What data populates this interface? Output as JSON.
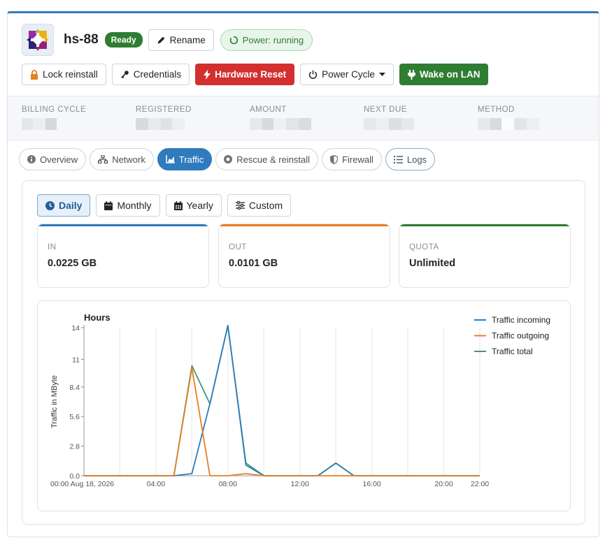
{
  "server": {
    "hostname": "hs-88",
    "status_badge": "Ready",
    "rename_label": "Rename",
    "power_status": "Power: running"
  },
  "actions": {
    "lock_reinstall": "Lock reinstall",
    "credentials": "Credentials",
    "hardware_reset": "Hardware Reset",
    "power_cycle": "Power Cycle",
    "wake_on_lan": "Wake on LAN"
  },
  "billing": {
    "billing_cycle": "BILLING CYCLE",
    "registered": "REGISTERED",
    "amount": "AMOUNT",
    "next_due": "NEXT DUE",
    "method": "METHOD"
  },
  "tabs": {
    "overview": "Overview",
    "network": "Network",
    "traffic": "Traffic",
    "rescue": "Rescue & reinstall",
    "firewall": "Firewall",
    "logs": "Logs"
  },
  "ranges": {
    "daily": "Daily",
    "monthly": "Monthly",
    "yearly": "Yearly",
    "custom": "Custom"
  },
  "stats": {
    "in_label": "IN",
    "in_value": "0.0225 GB",
    "out_label": "OUT",
    "out_value": "0.0101 GB",
    "quota_label": "QUOTA",
    "quota_value": "Unlimited"
  },
  "colors": {
    "accent": "#2f7bbd",
    "danger": "#d32f2f",
    "success": "#2e7d32",
    "incoming": "#2f7bbd",
    "outgoing": "#e67e22",
    "total": "#3a9a6e"
  },
  "chart_data": {
    "type": "line",
    "title": "Hours",
    "xlabel": "",
    "ylabel": "Traffic in MByte",
    "x": [
      "00:00",
      "01:00",
      "02:00",
      "03:00",
      "04:00",
      "05:00",
      "06:00",
      "07:00",
      "08:00",
      "09:00",
      "10:00",
      "11:00",
      "12:00",
      "13:00",
      "14:00",
      "15:00",
      "16:00",
      "17:00",
      "18:00",
      "19:00",
      "20:00",
      "21:00",
      "22:00"
    ],
    "x_tick_labels": [
      "00:00 Aug 18, 2026",
      "04:00",
      "08:00",
      "12:00",
      "16:00",
      "20:00",
      "22:00"
    ],
    "y_tick_labels": [
      "0.0",
      "2.8",
      "5.6",
      "8.4",
      "11",
      "14"
    ],
    "ylim": [
      0,
      14
    ],
    "grid": true,
    "legend_position": "top-right",
    "series": [
      {
        "name": "Traffic incoming",
        "color": "#2f7bbd",
        "values": [
          0,
          0,
          0,
          0,
          0,
          0,
          0.2,
          6.8,
          14.2,
          1.0,
          0,
          0,
          0,
          0,
          1.2,
          0,
          0,
          0,
          0,
          0,
          0,
          0,
          0
        ]
      },
      {
        "name": "Traffic outgoing",
        "color": "#e67e22",
        "values": [
          0,
          0,
          0,
          0,
          0,
          0,
          10.2,
          0,
          0,
          0.2,
          0,
          0,
          0,
          0,
          0,
          0,
          0,
          0,
          0,
          0,
          0,
          0,
          0
        ]
      },
      {
        "name": "Traffic total",
        "color": "#3a9a6e",
        "values": [
          0,
          0,
          0,
          0,
          0,
          0,
          10.4,
          6.8,
          14.2,
          1.2,
          0,
          0,
          0,
          0,
          1.2,
          0,
          0,
          0,
          0,
          0,
          0,
          0,
          0
        ]
      }
    ]
  }
}
